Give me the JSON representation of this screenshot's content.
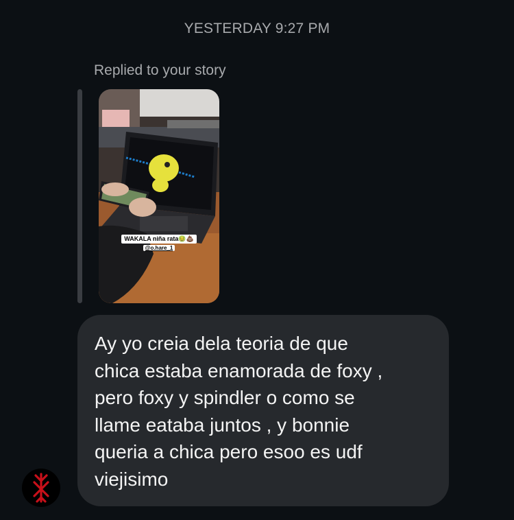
{
  "thread": {
    "timestamp": "YESTERDAY 9:27 PM"
  },
  "story_reply": {
    "label": "Replied to your story",
    "story": {
      "description": "photo",
      "caption_line1": "WAKALA niña rata🤢💩",
      "caption_line2": "@o.hare_1"
    }
  },
  "message": {
    "text": "Ay yo creia dela teoria de que\nchica estaba enamorada de foxy ,\npero foxy y spindler o como se\nllame eataba juntos , y bonnie\nqueria a chica pero esoo es udf\nviejisimo"
  },
  "sender": {
    "avatar_icon": "brand-of-sacrifice-icon",
    "avatar_color": "#c8101a"
  },
  "colors": {
    "background": "#0c1014",
    "bubble": "#26292d",
    "muted_text": "#a8aaad",
    "reply_bar": "#3a3d42"
  }
}
